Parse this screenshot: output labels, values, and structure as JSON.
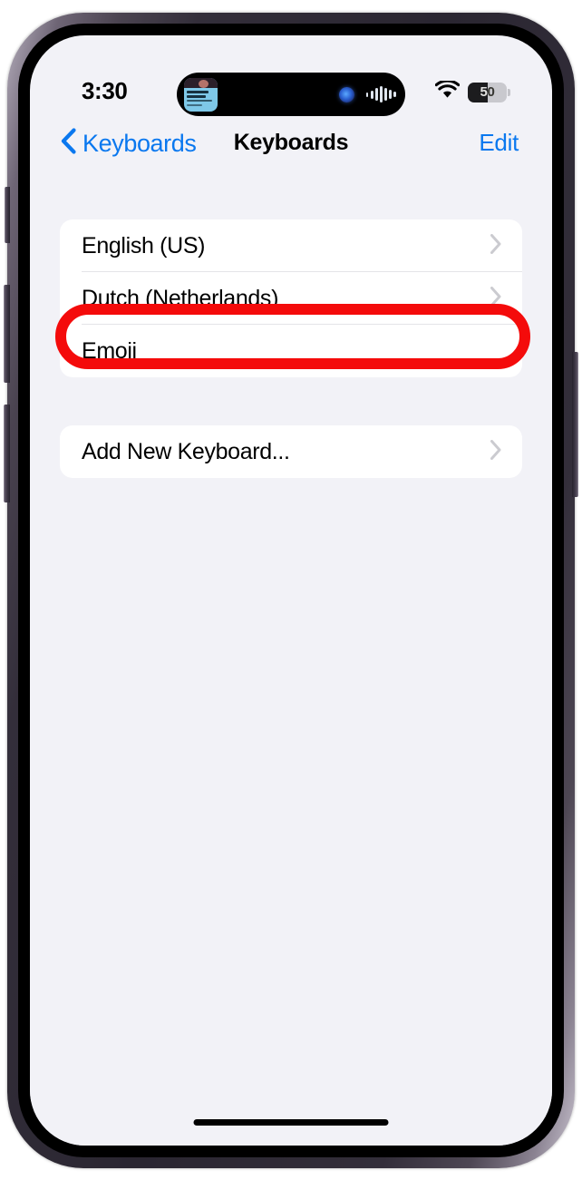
{
  "device": {
    "name": "iphone-14-pro",
    "frame_color": "#2a2631"
  },
  "status_bar": {
    "time": "3:30",
    "wifi_icon": "wifi-icon",
    "battery_level_text": "50",
    "battery_percent": 52,
    "dynamic_island": {
      "album_art_icon": "album-artwork",
      "siri_orb_icon": "siri-orb-icon",
      "waveform_icon": "audio-waveform-icon",
      "waveform_bars": [
        5,
        9,
        14,
        18,
        14,
        10,
        6
      ]
    }
  },
  "nav_bar": {
    "back_label": "Keyboards",
    "back_icon": "chevron-left-icon",
    "title": "Keyboards",
    "edit_label": "Edit",
    "accent_color": "#0a78ef"
  },
  "content": {
    "keyboard_group": [
      {
        "label": "English (US)",
        "chevron": true
      },
      {
        "label": "Dutch (Netherlands)",
        "chevron": true
      },
      {
        "label": "Emoji",
        "chevron": false,
        "highlighted": true
      }
    ],
    "add_group": [
      {
        "label": "Add New Keyboard...",
        "chevron": true
      }
    ]
  },
  "annotation": {
    "type": "red-oval-highlight",
    "target": "Emoji",
    "color": "#f40b0b"
  },
  "home_indicator": "home-indicator"
}
